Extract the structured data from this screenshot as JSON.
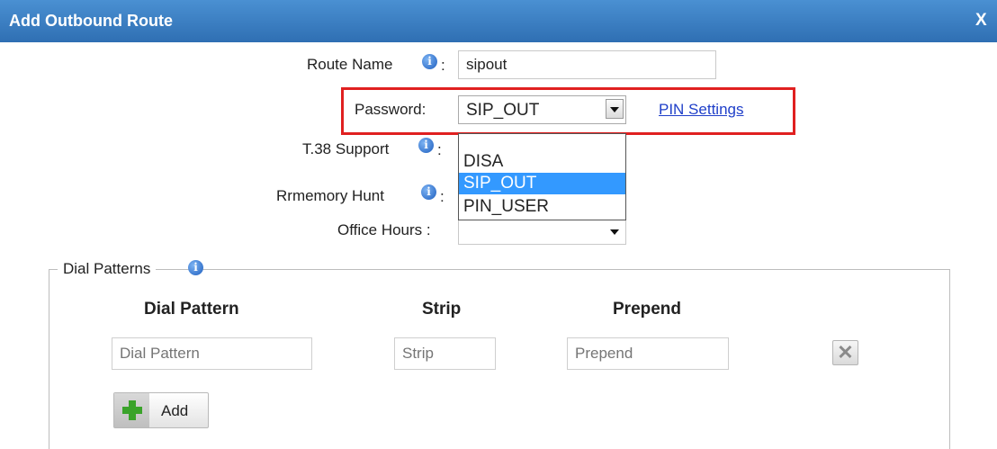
{
  "dialog": {
    "title": "Add Outbound Route",
    "close_label": "X"
  },
  "form": {
    "route_name": {
      "label": "Route Name",
      "colon": ":",
      "value": "sipout"
    },
    "password": {
      "label": "Password:",
      "selected": "SIP_OUT",
      "options": [
        "DISA",
        "SIP_OUT",
        "PIN_USER"
      ],
      "highlighted_option": "SIP_OUT"
    },
    "pin_settings_link": "PIN Settings",
    "t38_support": {
      "label": "T.38 Support",
      "colon": ":"
    },
    "rrmemory_hunt": {
      "label": "Rrmemory Hunt",
      "colon": ":"
    },
    "office_hours": {
      "label": "Office Hours :",
      "value": ""
    }
  },
  "dial_patterns": {
    "legend": "Dial Patterns",
    "columns": {
      "dial_pattern": "Dial Pattern",
      "strip": "Strip",
      "prepend": "Prepend"
    },
    "row": {
      "dial_pattern_placeholder": "Dial Pattern",
      "strip_placeholder": "Strip",
      "prepend_placeholder": "Prepend"
    },
    "add_label": "Add"
  },
  "icons": {
    "info": "info-icon",
    "close": "close-icon",
    "dropdown": "chevron-down-icon",
    "delete": "delete-x-icon",
    "add": "plus-icon"
  },
  "colors": {
    "titlebar": "#3a80c4",
    "highlight_box": "#e02020",
    "selected_option": "#3399ff",
    "link": "#1f3fc9",
    "plus": "#3aa32a"
  }
}
